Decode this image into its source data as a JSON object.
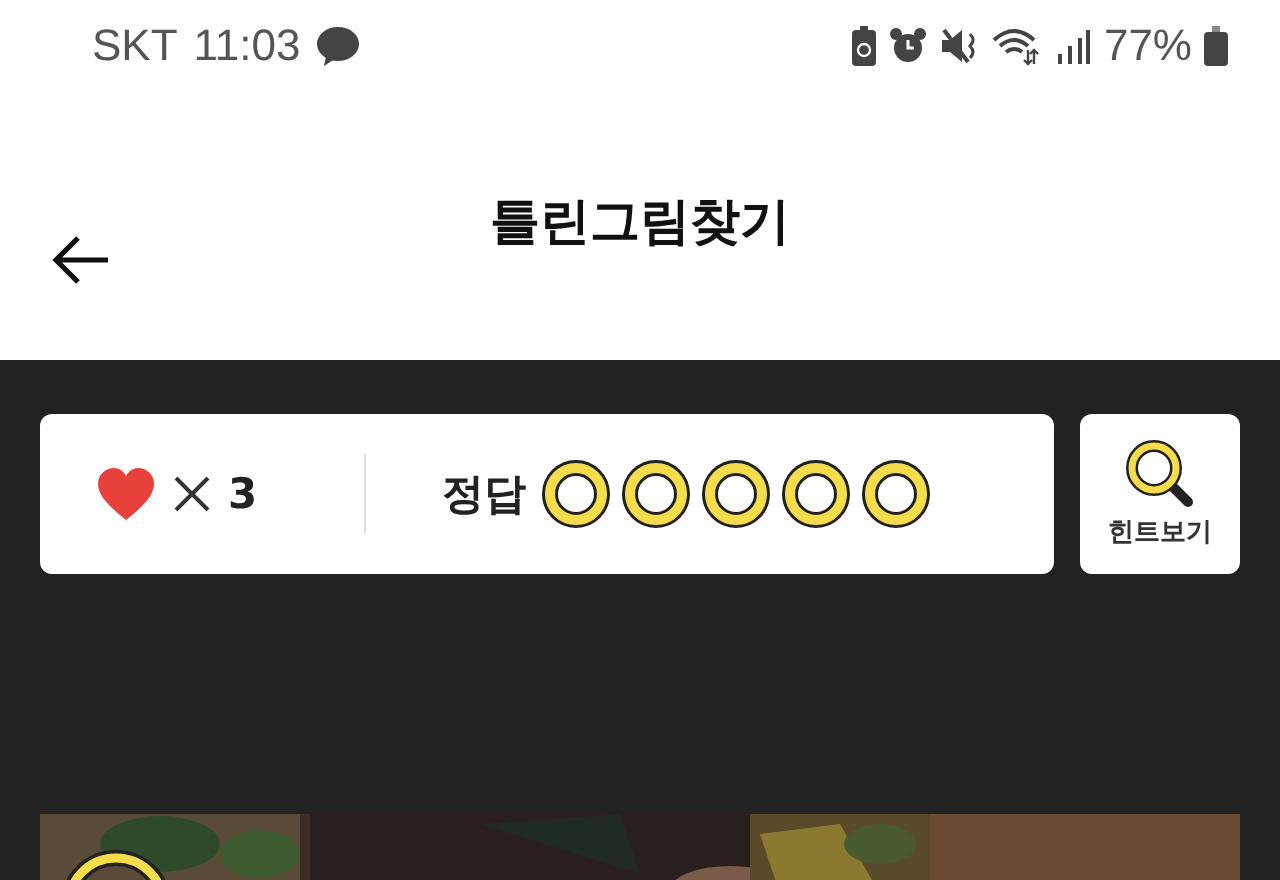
{
  "status_bar": {
    "carrier": "SKT",
    "time": "11:03",
    "battery_text": "77%"
  },
  "header": {
    "title": "틀린그림찾기"
  },
  "score": {
    "lives": "3",
    "answer_label": "정답",
    "answers": [
      {
        "found": false
      },
      {
        "found": false
      },
      {
        "found": false
      },
      {
        "found": false
      },
      {
        "found": false
      }
    ]
  },
  "hint_button": {
    "label": "힌트보기"
  }
}
